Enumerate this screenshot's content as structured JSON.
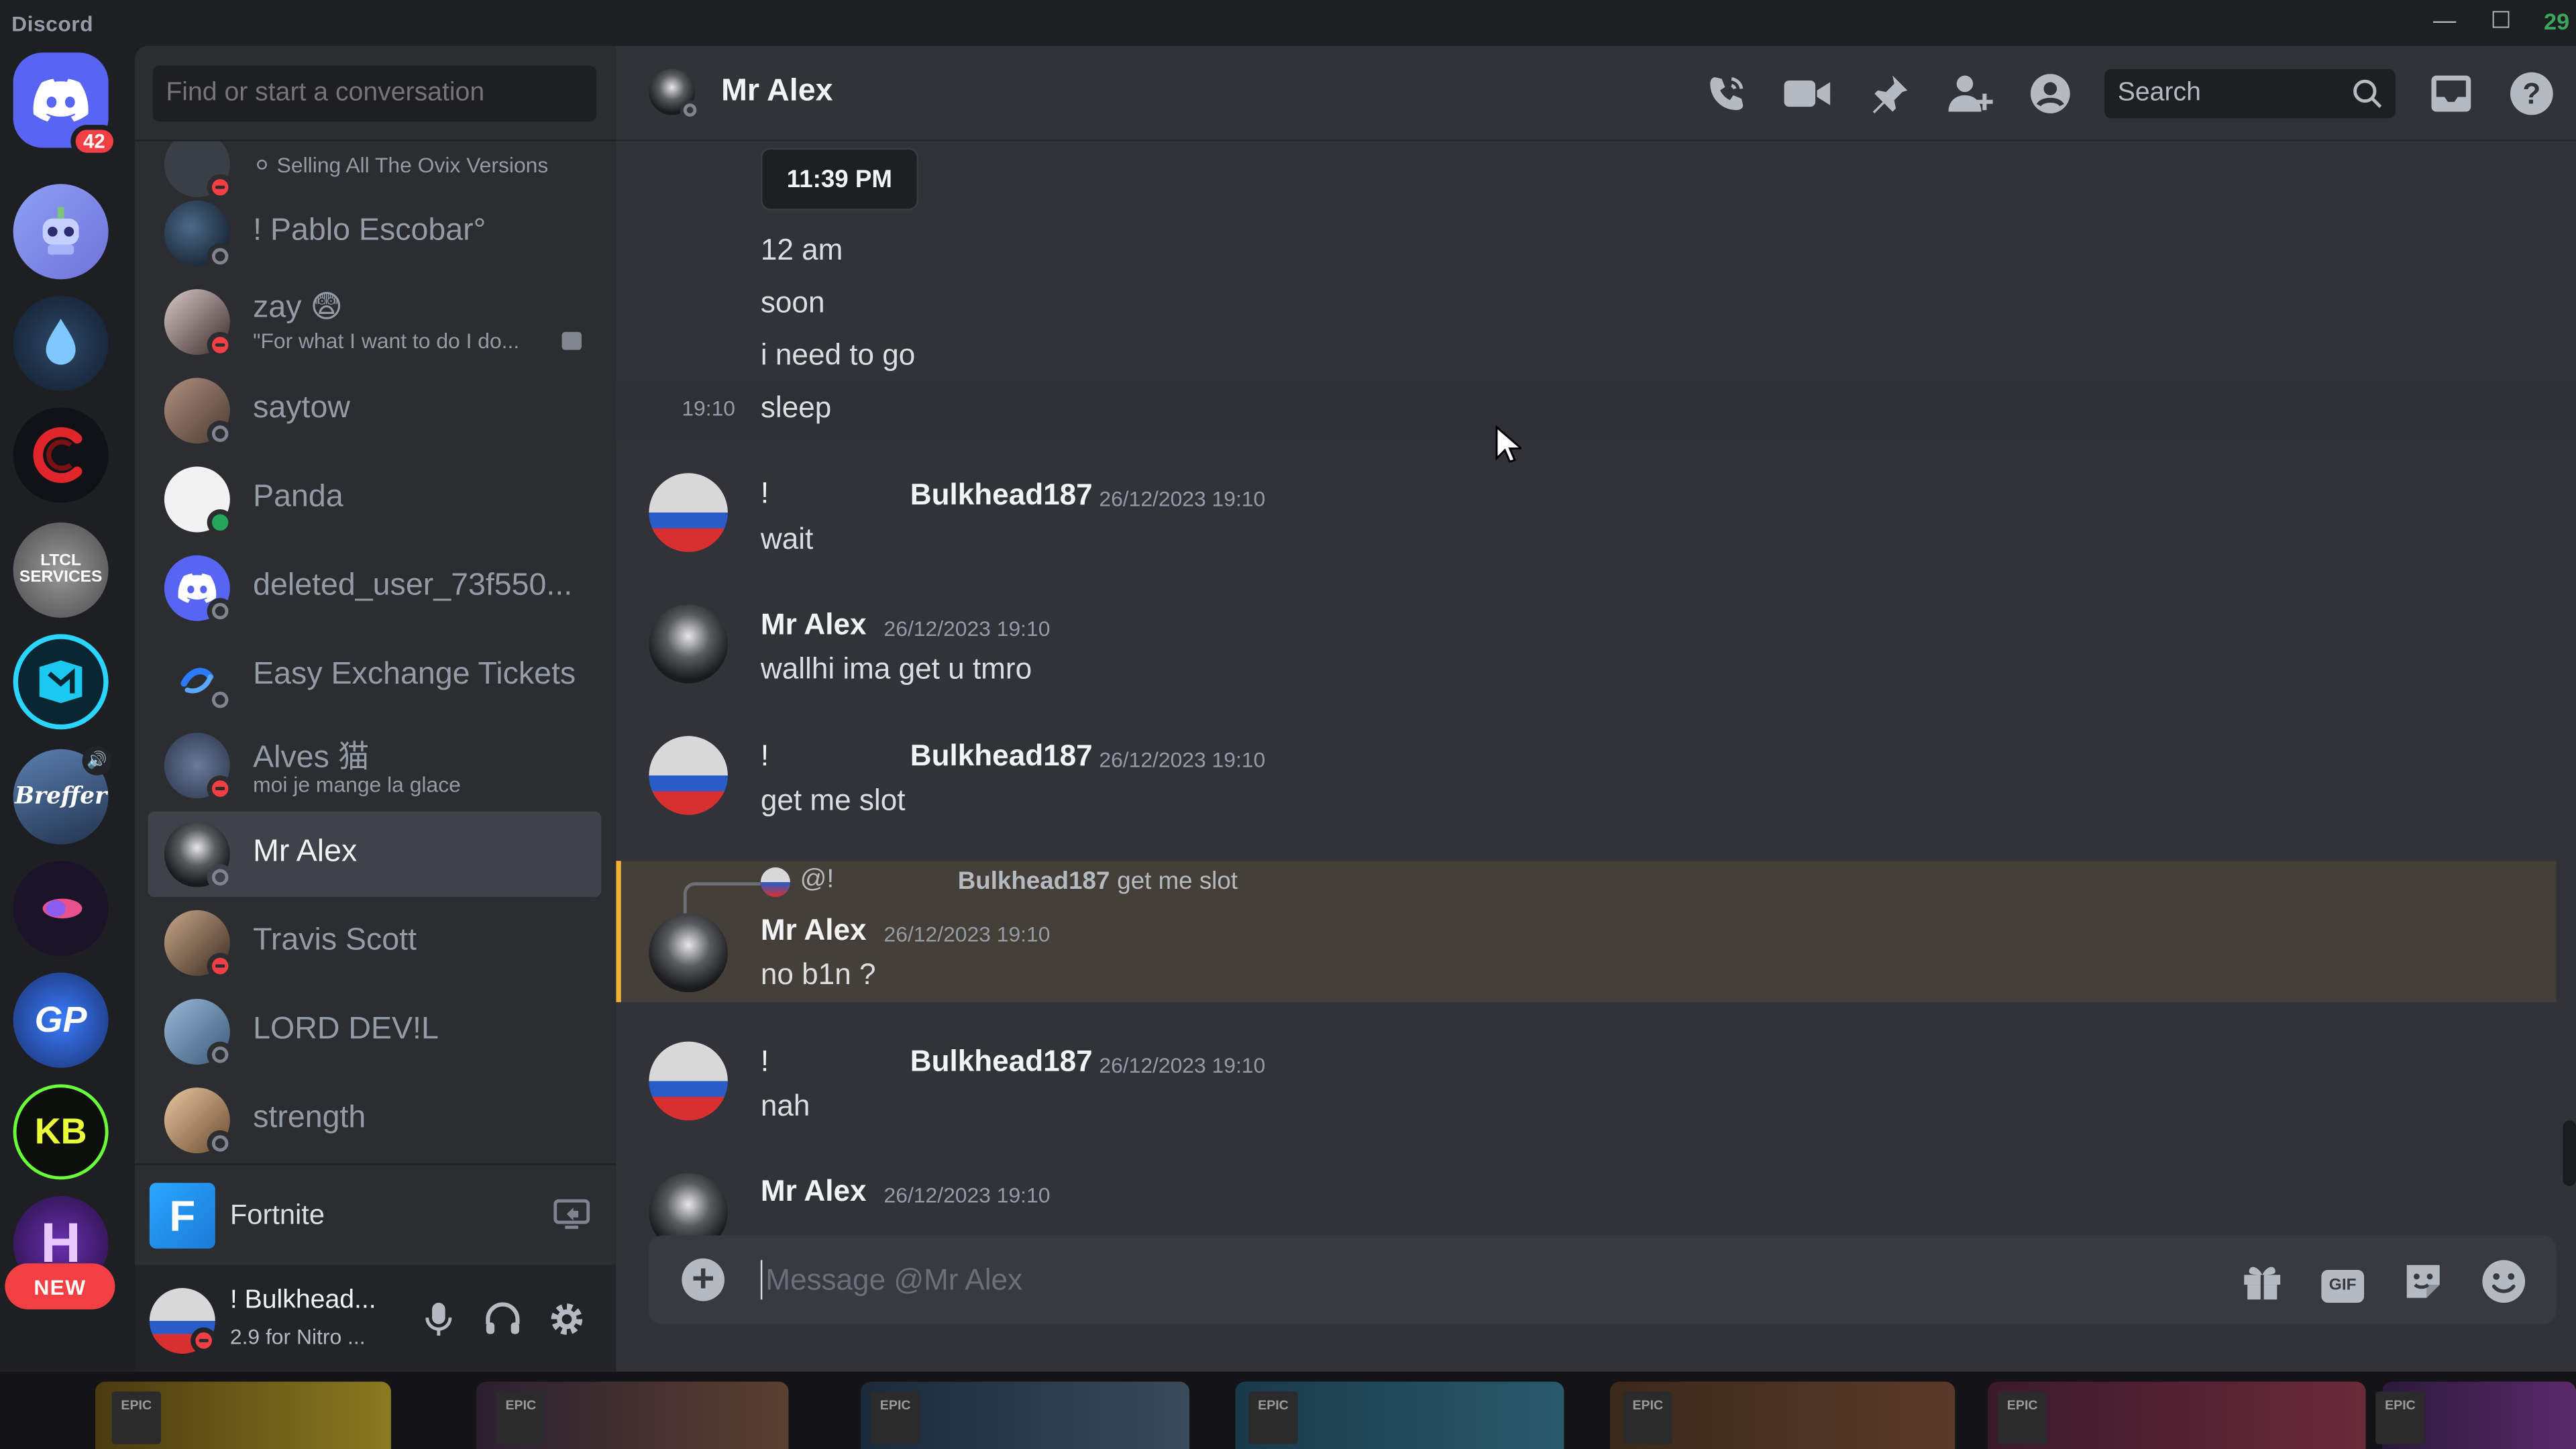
{
  "window": {
    "app_name": "Discord",
    "minimize": "—",
    "maximize": "☐",
    "corner_counter": "29"
  },
  "rail": {
    "home_badge": "42",
    "servers": [
      {
        "name": "robot-server",
        "color": "#7f7fd6",
        "glyph": "🤖"
      },
      {
        "name": "drop-server",
        "color": "#1d2c42",
        "glyph": "💧"
      },
      {
        "name": "c-server",
        "color": "#111318",
        "glyph": "C"
      },
      {
        "name": "ltcl-services",
        "color": "#6a6a6a",
        "glyph": "LTCL SERVICES"
      },
      {
        "name": "cyan-server",
        "color": "#0c2c3a",
        "glyph": "M"
      },
      {
        "name": "brefter-server",
        "color": "#2f4f7a",
        "glyph": "Breffer"
      },
      {
        "name": "comet-server",
        "color": "#1d1530",
        "glyph": "◐"
      },
      {
        "name": "gp-server",
        "color": "#1a3e85",
        "glyph": "GP"
      },
      {
        "name": "kb-server",
        "color": "#101410",
        "glyph": "KB"
      },
      {
        "name": "h-server",
        "color": "#3a1b5e",
        "glyph": "H"
      }
    ],
    "new_label": "NEW"
  },
  "dm": {
    "search_placeholder": "Find or start a conversation",
    "items": [
      {
        "name": "",
        "sub": "⚪ Selling All The Ovix Versions",
        "status": "dnd",
        "avatar": "#3a3f46"
      },
      {
        "name": "! Pablo Escobar°",
        "sub": "",
        "status": "off",
        "avatar": "#1f2a36"
      },
      {
        "name": "zay 😨",
        "sub": "\"For what I want to do I do...",
        "status": "dnd",
        "avatar": "#5a4a4a"
      },
      {
        "name": "saytow",
        "sub": "",
        "status": "off",
        "avatar": "#7a5a4a"
      },
      {
        "name": "Panda",
        "sub": "",
        "status": "on",
        "avatar": "#f2f2f2"
      },
      {
        "name": "deleted_user_73f550...",
        "sub": "",
        "status": "off",
        "avatar": "#5865f2"
      },
      {
        "name": "Easy Exchange Tickets",
        "sub": "",
        "status": "off",
        "avatar": "#2b2d31"
      },
      {
        "name": "Alves 猫",
        "sub": "moi je mange la glace",
        "status": "dnd",
        "avatar": "#4a5a7a"
      },
      {
        "name": "Mr Alex",
        "sub": "",
        "status": "off",
        "avatar": "#3a3c40"
      },
      {
        "name": "Travis Scott",
        "sub": "",
        "status": "dnd",
        "avatar": "#5a4a3a"
      },
      {
        "name": "LORD DEV!L",
        "sub": "",
        "status": "off",
        "avatar": "#4a6a8a"
      },
      {
        "name": "strength",
        "sub": "",
        "status": "off",
        "avatar": "#8a6a4a"
      }
    ],
    "activity": {
      "game": "Fortnite",
      "icon_letter": "F"
    },
    "user": {
      "name": "! Bulkhead...",
      "status": "2.9 for Nitro ..."
    }
  },
  "chat": {
    "title": "Mr Alex",
    "search_placeholder": "Search",
    "image_time": "11:39 PM",
    "messages": {
      "m1": "12 am",
      "m2": "soon",
      "m3": "i need to go",
      "m4_time": "19:10",
      "m4": "sleep",
      "g1_tag": "!",
      "g1_author": "Bulkhead187",
      "g1_ts": "26/12/2023 19:10",
      "g1_text": "wait",
      "g2_author": "Mr Alex",
      "g2_ts": "26/12/2023 19:10",
      "g2_text": "wallhi ima get u tmro",
      "g3_tag": "!",
      "g3_author": "Bulkhead187",
      "g3_ts": "26/12/2023 19:10",
      "g3_text": "get me slot",
      "reply_tag": "@!",
      "reply_author": "Bulkhead187",
      "reply_text": "get me slot",
      "g4_author": "Mr Alex",
      "g4_ts": "26/12/2023 19:10",
      "g4_text": "no b1n ?",
      "g5_tag": "!",
      "g5_author": "Bulkhead187",
      "g5_ts": "26/12/2023 19:10",
      "g5_text": "nah",
      "g6_author": "Mr Alex",
      "g6_ts": "26/12/2023 19:10"
    },
    "composer_placeholder": "Message @Mr Alex",
    "gif_label": "GIF"
  },
  "colors": {
    "accent": "#5865f2",
    "dnd": "#f23f43",
    "online": "#23a55a",
    "mention": "#f0b232"
  }
}
